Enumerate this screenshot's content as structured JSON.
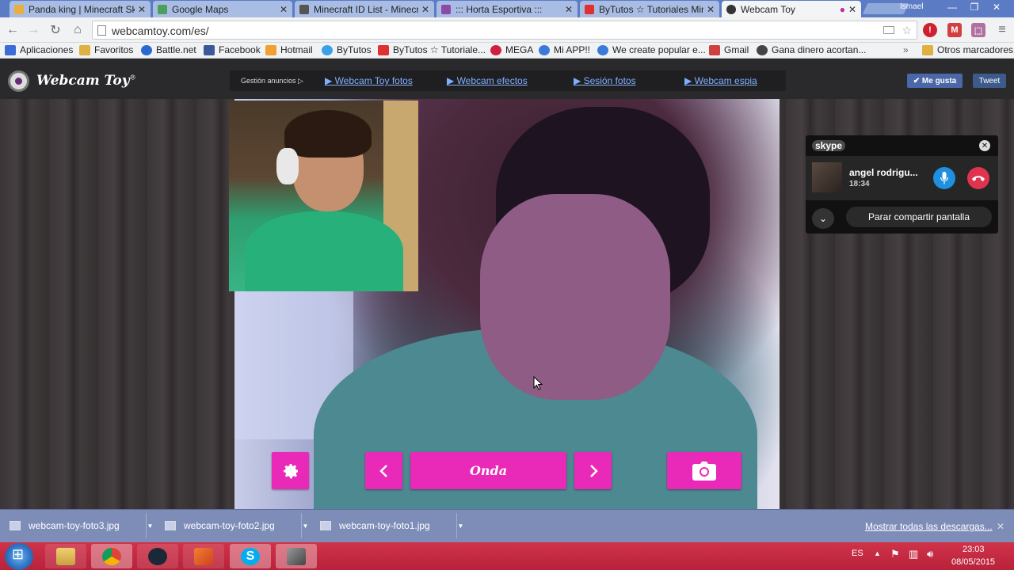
{
  "browser": {
    "tabs": [
      {
        "title": "Panda king | Minecraft Sk",
        "favicon_color": "#e8b040"
      },
      {
        "title": "Google Maps",
        "favicon_color": "#4aa05a"
      },
      {
        "title": "Minecraft ID List - Minecr",
        "favicon_color": "#555555"
      },
      {
        "title": "::: Horta Esportiva :::",
        "favicon_color": "#8a4aa8"
      },
      {
        "title": "ByTutos ☆ Tutoriales Min",
        "favicon_color": "#e03030"
      },
      {
        "title": "Webcam Toy",
        "favicon_color": "#333333",
        "active": true
      }
    ],
    "profile": "Ismael",
    "url": "webcamtoy.com/es/",
    "bookmarks": [
      {
        "label": "Aplicaciones",
        "color": "#3b6dd6"
      },
      {
        "label": "Favoritos",
        "color": "#e0b040"
      },
      {
        "label": "Battle.net",
        "color": "#2a6ad0"
      },
      {
        "label": "Facebook",
        "color": "#3b5998"
      },
      {
        "label": "Hotmail",
        "color": "#f0a030"
      },
      {
        "label": "ByTutos",
        "color": "#3aa0e8"
      },
      {
        "label": "ByTutos ☆ Tutoriale...",
        "color": "#e03030"
      },
      {
        "label": "MEGA",
        "color": "#d02040"
      },
      {
        "label": "Mi APP!!",
        "color": "#3a7ad8"
      },
      {
        "label": "We create popular e...",
        "color": "#3a7ad8"
      },
      {
        "label": "Gmail",
        "color": "#d04040"
      },
      {
        "label": "Gana dinero acortan...",
        "color": "#444444"
      },
      {
        "label": "Otros marcadores",
        "color": "#e0b040"
      }
    ],
    "overflow": "»"
  },
  "site": {
    "logo": "Webcam Toy",
    "logo_mark": "®",
    "nav_ads": "Gestión anuncios ▷",
    "nav": [
      "▶ Webcam Toy fotos",
      "▶ Webcam efectos",
      "▶ Sesión fotos",
      "▶ Webcam espia"
    ],
    "like": "✔ Me gusta",
    "tweet": "Tweet",
    "effect": "Onda"
  },
  "skype": {
    "logo": "skype",
    "contact_name": "angel rodrigu...",
    "call_time": "18:34",
    "share_button": "Parar compartir pantalla"
  },
  "downloads": {
    "files": [
      "webcam-toy-foto3.jpg",
      "webcam-toy-foto2.jpg",
      "webcam-toy-foto1.jpg"
    ],
    "show_all": "Mostrar todas las descargas..."
  },
  "taskbar": {
    "language": "ES",
    "time": "23:03",
    "date": "08/05/2015"
  },
  "colors": {
    "accent_pink": "#e92ab8",
    "skype_blue": "#1f8fe0",
    "hangup_red": "#e0344e"
  }
}
